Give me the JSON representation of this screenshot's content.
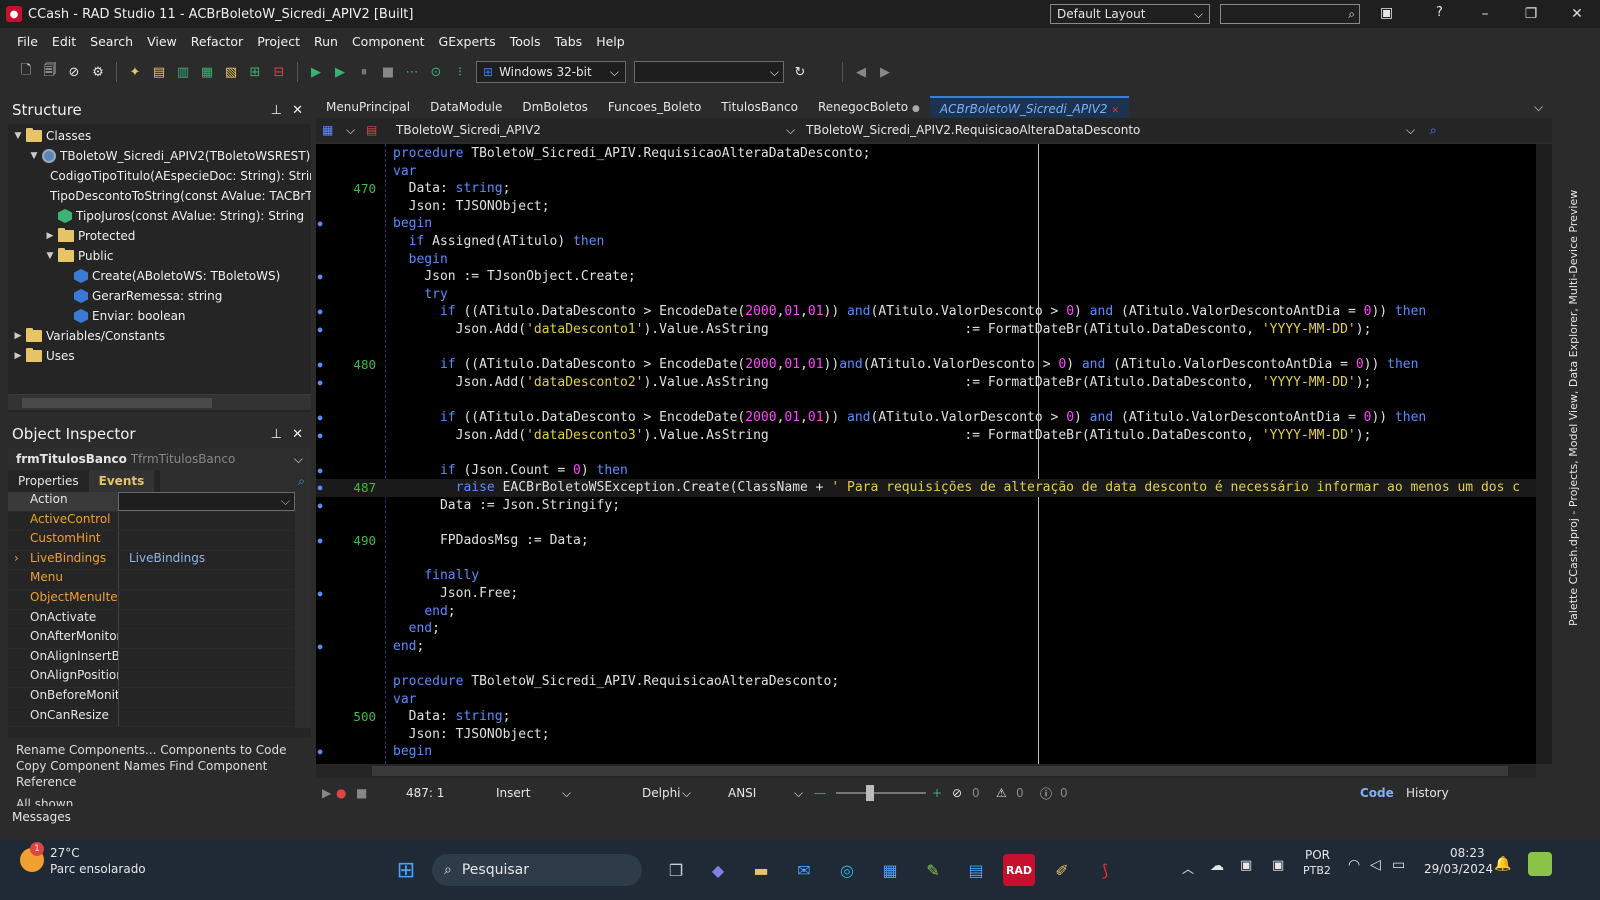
{
  "window": {
    "title": "CCash - RAD Studio 11 - ACBrBoletoW_Sicredi_APIV2 [Built]",
    "layout": "Default Layout"
  },
  "menu": [
    "File",
    "Edit",
    "Search",
    "View",
    "Refactor",
    "Project",
    "Run",
    "Component",
    "GExperts",
    "Tools",
    "Tabs",
    "Help"
  ],
  "toolbar": {
    "platform": "Windows 32-bit"
  },
  "structure": {
    "title": "Structure",
    "rows": [
      {
        "label": "Classes",
        "indent": 0,
        "toggle": "▼",
        "icon": "folder"
      },
      {
        "label": "TBoletoW_Sicredi_APIV2(TBoletoWSREST)",
        "indent": 1,
        "toggle": "▼",
        "icon": "class"
      },
      {
        "label": "CodigoTipoTitulo(AEspecieDoc: String): String",
        "indent": 2,
        "toggle": "",
        "icon": "green"
      },
      {
        "label": "TipoDescontoToString(const AValue: TACBrTipoDesconto",
        "indent": 2,
        "toggle": "",
        "icon": "green"
      },
      {
        "label": "TipoJuros(const AValue: String): String",
        "indent": 2,
        "toggle": "",
        "icon": "green"
      },
      {
        "label": "Protected",
        "indent": 2,
        "toggle": "▶",
        "icon": "folder"
      },
      {
        "label": "Public",
        "indent": 2,
        "toggle": "▼",
        "icon": "folder"
      },
      {
        "label": "Create(ABoletoWS: TBoletoWS)",
        "indent": 3,
        "toggle": "",
        "icon": "blue"
      },
      {
        "label": "GerarRemessa: string",
        "indent": 3,
        "toggle": "",
        "icon": "blue"
      },
      {
        "label": "Enviar: boolean",
        "indent": 3,
        "toggle": "",
        "icon": "blue"
      },
      {
        "label": "Variables/Constants",
        "indent": 0,
        "toggle": "▶",
        "icon": "folder"
      },
      {
        "label": "Uses",
        "indent": 0,
        "toggle": "▶",
        "icon": "folder"
      }
    ]
  },
  "inspector": {
    "title": "Object Inspector",
    "object": "frmTitulosBanco",
    "object_type": "TfrmTitulosBanco",
    "tabs": [
      "Properties",
      "Events"
    ],
    "rows": [
      {
        "name": "Action",
        "value": "",
        "orange": false,
        "sel": true
      },
      {
        "name": "ActiveControl",
        "value": "",
        "orange": true
      },
      {
        "name": "CustomHint",
        "value": "",
        "orange": true
      },
      {
        "name": "LiveBindings",
        "value": "LiveBindings",
        "orange": true,
        "expand": true
      },
      {
        "name": "Menu",
        "value": "",
        "orange": true
      },
      {
        "name": "ObjectMenuItem",
        "value": "",
        "orange": true
      },
      {
        "name": "OnActivate",
        "value": "",
        "orange": false
      },
      {
        "name": "OnAfterMonitorDpiChanged",
        "value": "",
        "orange": false
      },
      {
        "name": "OnAlignInsertBefore",
        "value": "",
        "orange": false
      },
      {
        "name": "OnAlignPosition",
        "value": "",
        "orange": false
      },
      {
        "name": "OnBeforeMonitorDpiChanged",
        "value": "",
        "orange": false
      },
      {
        "name": "OnCanResize",
        "value": "",
        "orange": false
      }
    ],
    "footer": [
      "Rename Components...  Components to Code",
      "Copy Component Names  Find Component Reference"
    ],
    "all_shown": "All shown"
  },
  "tabs": [
    {
      "label": "MenuPrincipal"
    },
    {
      "label": "DataModule"
    },
    {
      "label": "DmBoletos"
    },
    {
      "label": "Funcoes_Boleto"
    },
    {
      "label": "TitulosBanco"
    },
    {
      "label": "RenegocBoleto",
      "dot": "●"
    },
    {
      "label": "ACBrBoletoW_Sicredi_APIV2",
      "active": true,
      "dot": "✕"
    }
  ],
  "nav": {
    "class": "TBoletoW_Sicredi_APIV2",
    "method": "TBoletoW_Sicredi_APIV2.RequisicaoAlteraDataDesconto"
  },
  "code": [
    {
      "ln": "",
      "mk": "",
      "text": "procedure TBoletoW_Sicredi_APIV2.RequisicaoAlteraDataDesconto;"
    },
    {
      "ln": "",
      "mk": "",
      "text": "var"
    },
    {
      "ln": "470",
      "mk": "",
      "text": "  Data: string;"
    },
    {
      "ln": "",
      "mk": "",
      "text": "  Json: TJSONObject;"
    },
    {
      "ln": "",
      "mk": "●",
      "text": "begin"
    },
    {
      "ln": "",
      "mk": "",
      "text": "  if Assigned(ATitulo) then"
    },
    {
      "ln": "",
      "mk": "",
      "text": "  begin"
    },
    {
      "ln": "",
      "mk": "●",
      "text": "    Json := TJsonObject.Create;"
    },
    {
      "ln": "",
      "mk": "",
      "text": "    try"
    },
    {
      "ln": "",
      "mk": "●",
      "text": "      if ((ATitulo.DataDesconto > EncodeDate(2000,01,01)) and(ATitulo.ValorDesconto > 0) and (ATitulo.ValorDescontoAntDia = 0)) then"
    },
    {
      "ln": "",
      "mk": "●",
      "text": "        Json.Add('dataDesconto1').Value.AsString                         := FormatDateBr(ATitulo.DataDesconto, 'YYYY-MM-DD');"
    },
    {
      "ln": "",
      "mk": "",
      "text": ""
    },
    {
      "ln": "480",
      "mk": "●",
      "text": "      if ((ATitulo.DataDesconto2 > EncodeDate(2000,01,01))and(ATitulo.ValorDesconto2 > 0) and (ATitulo.ValorDescontoAntDia = 0)) then"
    },
    {
      "ln": "",
      "mk": "●",
      "text": "        Json.Add('dataDesconto2').Value.AsString                         := FormatDateBr(ATitulo.DataDesconto2, 'YYYY-MM-DD');"
    },
    {
      "ln": "",
      "mk": "",
      "text": ""
    },
    {
      "ln": "",
      "mk": "●",
      "text": "      if ((ATitulo.DataDesconto3 > EncodeDate(2000,01,01)) and(ATitulo.ValorDesconto3 > 0) and (ATitulo.ValorDescontoAntDia = 0)) then"
    },
    {
      "ln": "",
      "mk": "●",
      "text": "        Json.Add('dataDesconto3').Value.AsString                         := FormatDateBr(ATitulo.DataDesconto3, 'YYYY-MM-DD');"
    },
    {
      "ln": "",
      "mk": "",
      "text": ""
    },
    {
      "ln": "",
      "mk": "●",
      "text": "      if (Json.Count = 0) then"
    },
    {
      "ln": "487",
      "mk": "●",
      "text": "        raise EACBrBoletoWSException.Create(ClassName + ' Para requisições de alteração de data desconto é necessário informar ao menos um dos c",
      "cur": true
    },
    {
      "ln": "",
      "mk": "●",
      "text": "      Data := Json.Stringify;"
    },
    {
      "ln": "",
      "mk": "",
      "text": ""
    },
    {
      "ln": "490",
      "mk": "●",
      "text": "      FPDadosMsg := Data;"
    },
    {
      "ln": "",
      "mk": "",
      "text": ""
    },
    {
      "ln": "",
      "mk": "",
      "text": "    finally"
    },
    {
      "ln": "",
      "mk": "●",
      "text": "      Json.Free;"
    },
    {
      "ln": "",
      "mk": "",
      "text": "    end;"
    },
    {
      "ln": "",
      "mk": "",
      "text": "  end;"
    },
    {
      "ln": "",
      "mk": "●",
      "text": "end;"
    },
    {
      "ln": "",
      "mk": "",
      "text": ""
    },
    {
      "ln": "",
      "mk": "",
      "text": "procedure TBoletoW_Sicredi_APIV2.RequisicaoAlteraDesconto;"
    },
    {
      "ln": "",
      "mk": "",
      "text": "var"
    },
    {
      "ln": "500",
      "mk": "",
      "text": "  Data: string;"
    },
    {
      "ln": "",
      "mk": "",
      "text": "  Json: TJSONObject;"
    },
    {
      "ln": "",
      "mk": "●",
      "text": "begin"
    }
  ],
  "status": {
    "pos": "487:  1",
    "mode": "Insert",
    "lang": "Delphi",
    "enc": "ANSI",
    "c1": "0",
    "c2": "0",
    "c3": "0",
    "code_tab": "Code",
    "history_tab": "History"
  },
  "right_bar": "Palette  CCash.dproj - Projects, Model View, Data Explorer, Multi-Device Preview",
  "messages": "Messages",
  "taskbar": {
    "temp": "27°C",
    "weather": "Parc ensolarado",
    "search": "Pesquisar",
    "lang1": "POR",
    "lang2": "PTB2",
    "time": "08:23",
    "date": "29/03/2024",
    "badge": "1"
  }
}
